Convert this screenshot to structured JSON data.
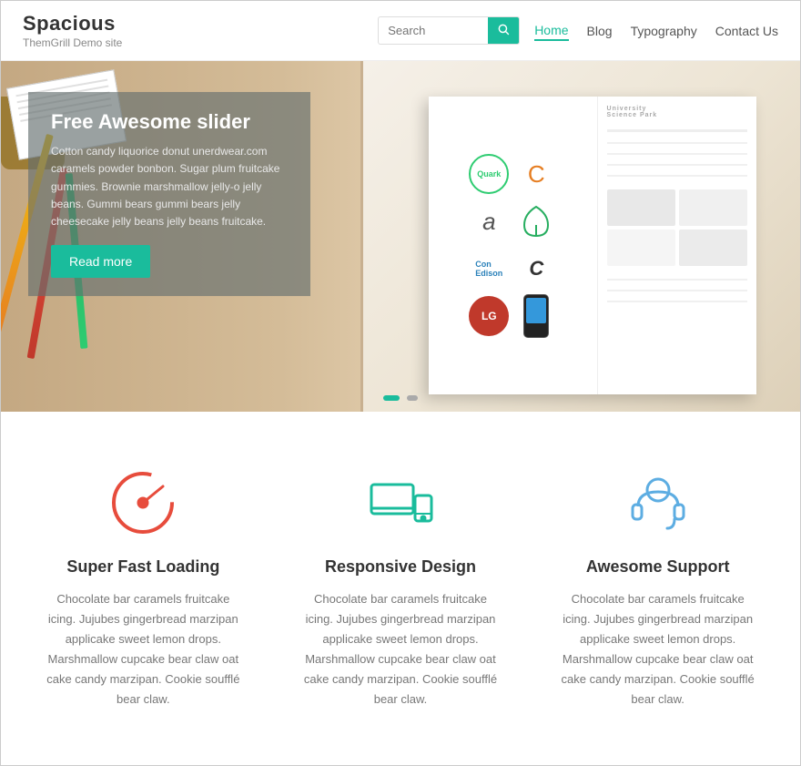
{
  "site": {
    "title": "Spacious",
    "tagline": "ThemGrill Demo site"
  },
  "header": {
    "search_placeholder": "Search",
    "nav_items": [
      {
        "label": "Home",
        "active": true
      },
      {
        "label": "Blog",
        "active": false
      },
      {
        "label": "Typography",
        "active": false
      },
      {
        "label": "Contact Us",
        "active": false
      }
    ]
  },
  "slider": {
    "title": "Free Awesome slider",
    "description": "Cotton candy liquorice donut unerdwear.com caramels powder bonbon. Sugar plum fruitcake gummies. Brownie marshmallow jelly-o jelly beans. Gummi bears gummi bears jelly cheesecake jelly beans jelly beans fruitcake.",
    "button_label": "Read more",
    "dots": [
      {
        "active": true
      },
      {
        "active": false
      }
    ]
  },
  "features": [
    {
      "title": "Super Fast Loading",
      "description": "Chocolate bar caramels fruitcake icing. Jujubes gingerbread marzipan applicake sweet lemon drops. Marshmallow cupcake bear claw oat cake candy marzipan. Cookie soufflé bear claw.",
      "icon": "speed"
    },
    {
      "title": "Responsive Design",
      "description": "Chocolate bar caramels fruitcake icing. Jujubes gingerbread marzipan applicake sweet lemon drops. Marshmallow cupcake bear claw oat cake candy marzipan. Cookie soufflé bear claw.",
      "icon": "responsive"
    },
    {
      "title": "Awesome Support",
      "description": "Chocolate bar caramels fruitcake icing. Jujubes gingerbread marzipan applicake sweet lemon drops. Marshmallow cupcake bear claw oat cake candy marzipan. Cookie soufflé bear claw.",
      "icon": "support"
    }
  ],
  "colors": {
    "primary": "#1abc9c",
    "accent_red": "#e74c3c",
    "accent_blue": "#5dade2"
  }
}
